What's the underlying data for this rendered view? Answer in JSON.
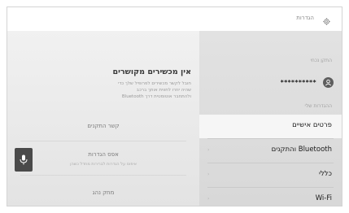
{
  "header": {
    "title": "הגדרות",
    "icon": "gear-icon"
  },
  "sidebar": {
    "user_label": "התקן נכחי",
    "password_mask": "**********",
    "my_settings_label": "ההגדרות שלי",
    "items": [
      {
        "label": "פרטים אישיים",
        "selected": true
      },
      {
        "label": "Bluetooth והתקנים",
        "selected": false
      },
      {
        "label": "כללי",
        "selected": false
      },
      {
        "label": "Wi-Fi",
        "selected": false
      }
    ]
  },
  "main": {
    "title": "אין מכשירים מקושרים",
    "desc_lines": [
      "חובל לקשר מכשירים לפרופיל שלך כדי",
      "שהיה יוזרו לחווית אותך ברכב",
      "ולהתחבר אוטומטית דרך Bluetooth"
    ],
    "link_devices": "קשר התקנים",
    "reset_settings": "אפס הגדרות",
    "reset_sub": "איפוס על הגדרות לברירות מחדל כשהן",
    "delete_driver": "מחק נהג"
  },
  "colors": {
    "selected_bg": "#f6f6f6",
    "sidebar_bg": "#dcdcdc",
    "main_bg": "#ebebeb",
    "mic_bg": "#4a4a4a"
  }
}
